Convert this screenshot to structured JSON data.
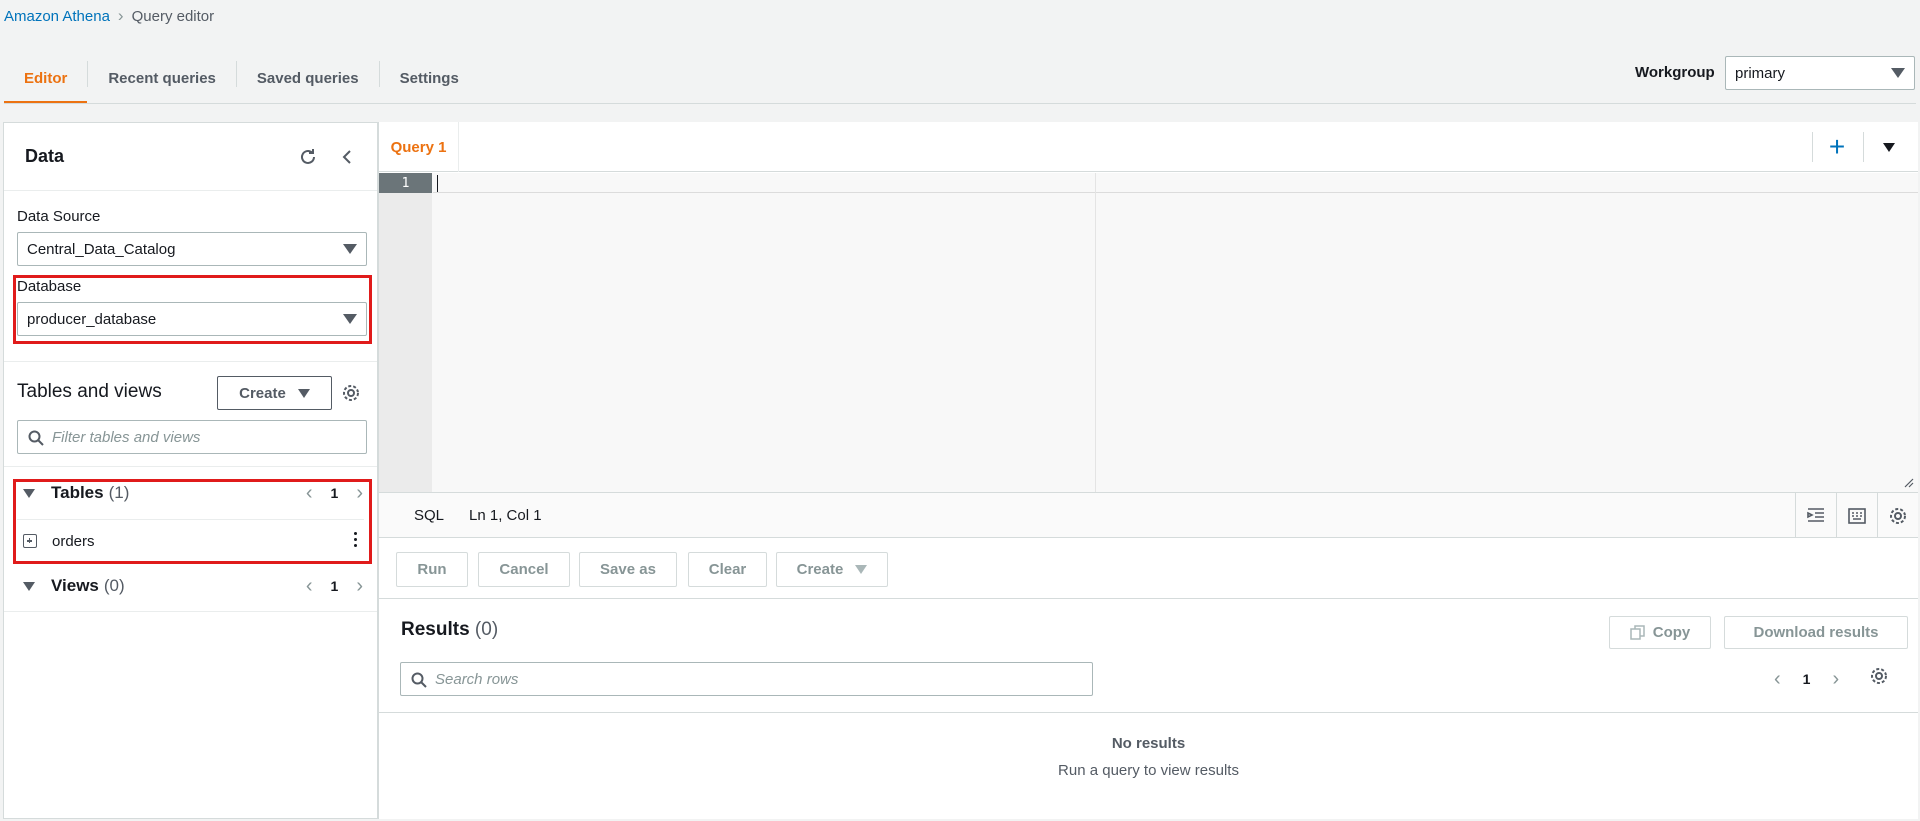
{
  "breadcrumb": {
    "root": "Amazon Athena",
    "current": "Query editor"
  },
  "tabs": [
    {
      "label": "Editor",
      "active": true
    },
    {
      "label": "Recent queries",
      "active": false
    },
    {
      "label": "Saved queries",
      "active": false
    },
    {
      "label": "Settings",
      "active": false
    }
  ],
  "workgroup": {
    "label": "Workgroup",
    "value": "primary"
  },
  "data_panel": {
    "title": "Data",
    "data_source_label": "Data Source",
    "data_source_value": "Central_Data_Catalog",
    "database_label": "Database",
    "database_value": "producer_database",
    "tables_views_title": "Tables and views",
    "create_label": "Create",
    "filter_placeholder": "Filter tables and views",
    "tables": {
      "title": "Tables",
      "count": "(1)",
      "page": "1",
      "items": [
        "orders"
      ]
    },
    "views": {
      "title": "Views",
      "count": "(0)",
      "page": "1"
    }
  },
  "editor": {
    "query_tab": "Query 1",
    "line_number": "1",
    "language": "SQL",
    "position": "Ln 1, Col 1"
  },
  "actions": {
    "run": "Run",
    "cancel": "Cancel",
    "save_as": "Save as",
    "clear": "Clear",
    "create": "Create"
  },
  "results": {
    "title": "Results",
    "count": "(0)",
    "copy": "Copy",
    "download": "Download results",
    "search_placeholder": "Search rows",
    "page": "1",
    "empty_title": "No results",
    "empty_subtitle": "Run a query to view results"
  },
  "colors": {
    "accent": "#ec7211",
    "link": "#0073bb",
    "highlight_box": "#e01b1b"
  },
  "icons": [
    "refresh-icon",
    "collapse-icon",
    "gear-icon",
    "search-icon",
    "plus-icon",
    "chevron-left-icon",
    "chevron-right-icon",
    "expand-icon",
    "kebab-icon",
    "format-icon",
    "keyboard-icon",
    "copy-icon",
    "resize-icon"
  ]
}
